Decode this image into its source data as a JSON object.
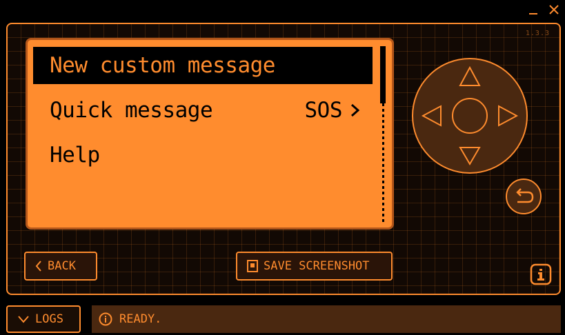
{
  "app": {
    "version": "1.3.3"
  },
  "screen": {
    "menu": [
      {
        "label": "New custom message",
        "value": "",
        "selected": true
      },
      {
        "label": "Quick message",
        "value": "SOS",
        "has_arrow": true
      },
      {
        "label": "Help",
        "value": ""
      }
    ],
    "scroll_position": 0.0
  },
  "buttons": {
    "back_label": "BACK",
    "save_screenshot_label": "SAVE SCREENSHOT",
    "logs_label": "LOGS"
  },
  "status": {
    "text": "READY."
  },
  "icons": {
    "minimize": "minimize-icon",
    "close": "close-icon",
    "dpad_up": "triangle-up-icon",
    "dpad_down": "triangle-down-icon",
    "dpad_left": "triangle-left-icon",
    "dpad_right": "triangle-right-icon",
    "dpad_center": "circle-icon",
    "return": "return-arrow-icon",
    "info": "info-icon",
    "chevron_left": "chevron-left-icon",
    "floppy": "save-icon",
    "chevron_down": "chevron-down-icon"
  },
  "colors": {
    "accent": "#ff8c2e",
    "screen_border": "#b3561a",
    "dark_panel": "#4a2810",
    "background": "#000000"
  }
}
